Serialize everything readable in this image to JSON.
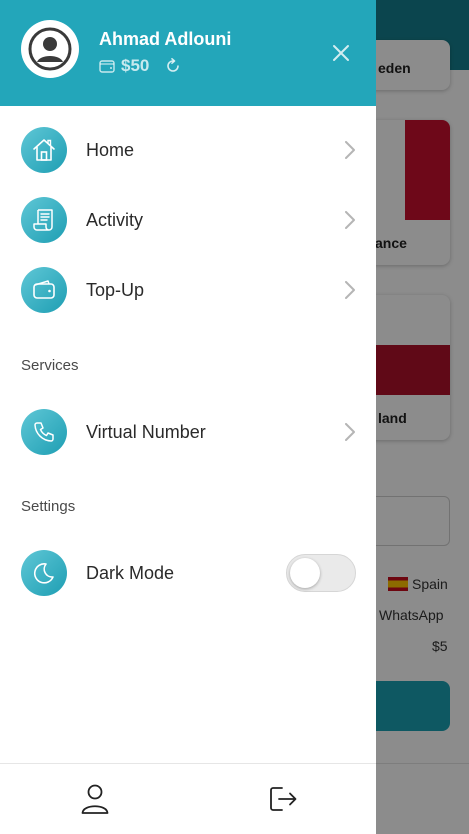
{
  "background": {
    "card1_text": "eden",
    "card2_text": "ance",
    "card3_text": "land",
    "country": "Spain",
    "service": "WhatsApp",
    "price": "$5"
  },
  "drawer": {
    "user_name": "Ahmad Adlouni",
    "balance": "$50",
    "menu": [
      {
        "label": "Home",
        "icon": "home-icon"
      },
      {
        "label": "Activity",
        "icon": "receipt-icon"
      },
      {
        "label": "Top-Up",
        "icon": "wallet-icon"
      }
    ],
    "services_title": "Services",
    "services": [
      {
        "label": "Virtual Number",
        "icon": "phone-icon"
      }
    ],
    "settings_title": "Settings",
    "settings": [
      {
        "label": "Dark Mode",
        "icon": "moon-icon",
        "toggle": false
      }
    ],
    "footer": {
      "left_icon": "profile-icon",
      "right_icon": "logout-icon"
    }
  },
  "colors": {
    "accent": "#23a6ba",
    "icon_gradient_start": "#5fc7d6",
    "icon_gradient_end": "#1e9eb3"
  }
}
